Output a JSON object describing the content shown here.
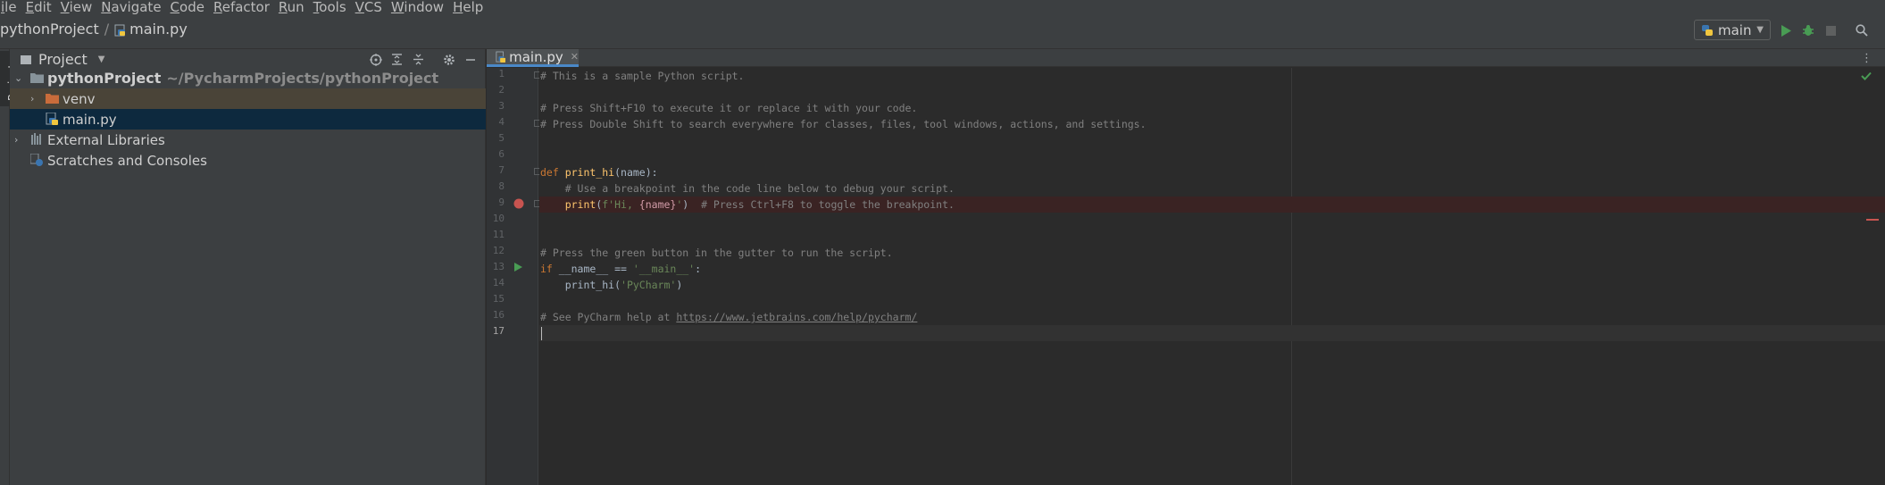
{
  "menu": [
    "File",
    "Edit",
    "View",
    "Navigate",
    "Code",
    "Refactor",
    "Run",
    "Tools",
    "VCS",
    "Window",
    "Help"
  ],
  "menu_display": [
    "ile",
    "Edit",
    "View",
    "Navigate",
    "Code",
    "Refactor",
    "Run",
    "Tools",
    "VCS",
    "Window",
    "Help"
  ],
  "breadcrumb": {
    "project": "pythonProject",
    "file": "main.py"
  },
  "run_config": {
    "name": "main"
  },
  "project_panel": {
    "title": "Project",
    "tool_window_label": "Project",
    "tree": [
      {
        "label": "pythonProject",
        "sub": "~/PycharmProjects/pythonProject",
        "icon": "folder-icon"
      },
      {
        "label": "venv",
        "icon": "folder-excluded-icon"
      },
      {
        "label": "main.py",
        "icon": "python-file-icon"
      },
      {
        "label": "External Libraries",
        "icon": "libraries-icon"
      },
      {
        "label": "Scratches and Consoles",
        "icon": "scratches-icon"
      }
    ]
  },
  "editor": {
    "tab": "main.py",
    "line_numbers": [
      "1",
      "2",
      "3",
      "4",
      "5",
      "6",
      "7",
      "8",
      "9",
      "10",
      "11",
      "12",
      "13",
      "14",
      "15",
      "16",
      "17"
    ],
    "lines": {
      "l1": "# This is a sample Python script.",
      "l3": "# Press Shift+F10 to execute it or replace it with your code.",
      "l4": "# Press Double Shift to search everywhere for classes, files, tool windows, actions, and settings.",
      "l7_kw": "def ",
      "l7_fn": "print_hi",
      "l7_rest": "(name):",
      "l8": "    # Use a breakpoint in the code line below to debug your script.",
      "l9_fn": "    print",
      "l9_a": "(",
      "l9_str1": "f'Hi, ",
      "l9_var": "{name}",
      "l9_str2": "'",
      "l9_b": ")  ",
      "l9_comment": "# Press Ctrl+F8 to toggle the breakpoint.",
      "l12": "# Press the green button in the gutter to run the script.",
      "l13_kw": "if ",
      "l13_a": "__name__ == ",
      "l13_str": "'__main__'",
      "l13_b": ":",
      "l14_a": "    print_hi(",
      "l14_str": "'PyCharm'",
      "l14_b": ")",
      "l16_a": "# See PyCharm help at ",
      "l16_link": "https://www.jetbrains.com/help/pycharm/"
    }
  },
  "colors": {
    "background": "#2b2b2b",
    "panel": "#3c3f41",
    "selection": "#0d293e",
    "keyword": "#cc7832",
    "function": "#ffc66d",
    "string": "#6a8759",
    "comment": "#808080",
    "breakpoint": "#c75450",
    "run": "#499c54"
  }
}
